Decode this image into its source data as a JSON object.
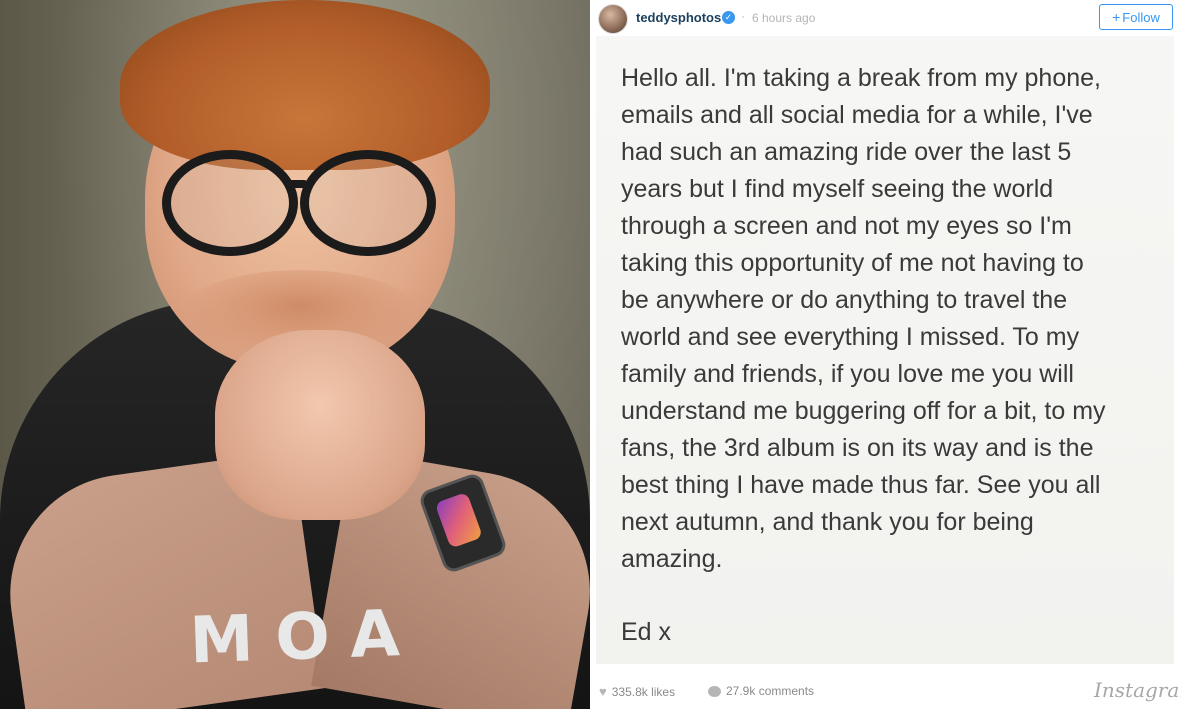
{
  "post": {
    "username": "teddysphotos",
    "separator": "·",
    "time": "6 hours ago",
    "follow_label": "Follow",
    "follow_plus": "+",
    "verified_mark": "✓",
    "note_text": "Hello all. I'm taking a break from my phone,\nemails and all social media for a while, I've\nhad such an amazing ride over the last 5\nyears but I find myself seeing the world\nthrough a screen and not my eyes so I'm\ntaking this opportunity of me not having to\nbe anywhere or do anything to travel the\nworld and see everything I missed. To my\nfamily and friends, if you love me you will\nunderstand me buggering off for a bit, to my\nfans, the 3rd album is on its way and is the\nbest thing I have made thus far. See you all\nnext autumn, and thank you for being\namazing.",
    "signoff": "Ed x",
    "likes": "335.8k likes",
    "comments": "27.9k comments",
    "brand": "Instagram"
  },
  "photo": {
    "shirt_text": "MOA"
  },
  "colors": {
    "accent": "#3897f0",
    "username": "#1b3f5c",
    "muted": "#8a8a8a"
  },
  "icons": {
    "verified": "verified-badge-icon",
    "heart": "heart-icon",
    "comment": "comment-bubble-icon"
  }
}
